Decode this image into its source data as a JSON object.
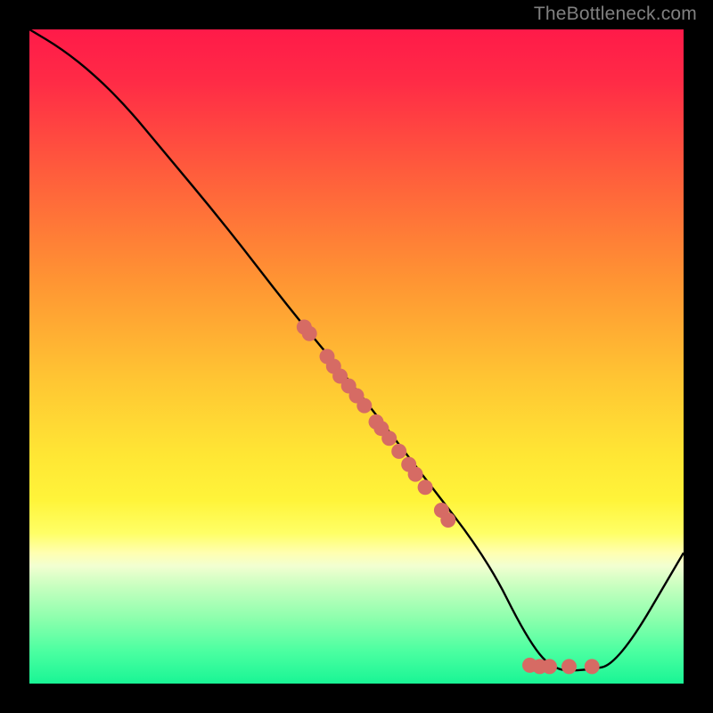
{
  "attribution": "TheBottleneck.com",
  "colors": {
    "page_bg": "#000000",
    "attribution": "#808080",
    "curve": "#000000",
    "dot": "#d66b64",
    "gradient_top": "#ff1a49",
    "gradient_bottom": "#19f595"
  },
  "chart_data": {
    "type": "line",
    "title": "",
    "xlabel": "",
    "ylabel": "",
    "xlim": [
      0,
      100
    ],
    "ylim": [
      0,
      100
    ],
    "grid": false,
    "legend": false,
    "note": "Line shows bottleneck-style curve; dots clustered along the descending segment and near the trough. Values estimated from pixel positions (no axes/ticks present).",
    "series": [
      {
        "name": "curve",
        "x": [
          0,
          5,
          10,
          15,
          20,
          30,
          40,
          50,
          60,
          70,
          76,
          80,
          85,
          90,
          100
        ],
        "y": [
          100,
          97,
          93,
          88,
          82,
          70,
          57,
          45,
          32,
          19,
          7,
          2,
          2,
          3,
          20
        ]
      }
    ],
    "points": [
      {
        "x": 42.0,
        "y": 54.5
      },
      {
        "x": 42.8,
        "y": 53.5
      },
      {
        "x": 45.5,
        "y": 50.0
      },
      {
        "x": 46.5,
        "y": 48.5
      },
      {
        "x": 47.5,
        "y": 47.0
      },
      {
        "x": 48.8,
        "y": 45.5
      },
      {
        "x": 50.0,
        "y": 44.0
      },
      {
        "x": 51.2,
        "y": 42.5
      },
      {
        "x": 53.0,
        "y": 40.0
      },
      {
        "x": 53.8,
        "y": 39.0
      },
      {
        "x": 55.0,
        "y": 37.5
      },
      {
        "x": 56.5,
        "y": 35.5
      },
      {
        "x": 58.0,
        "y": 33.5
      },
      {
        "x": 59.0,
        "y": 32.0
      },
      {
        "x": 60.5,
        "y": 30.0
      },
      {
        "x": 63.0,
        "y": 26.5
      },
      {
        "x": 64.0,
        "y": 25.0
      },
      {
        "x": 76.5,
        "y": 2.8
      },
      {
        "x": 78.0,
        "y": 2.6
      },
      {
        "x": 79.5,
        "y": 2.6
      },
      {
        "x": 82.5,
        "y": 2.6
      },
      {
        "x": 86.0,
        "y": 2.6
      }
    ]
  }
}
